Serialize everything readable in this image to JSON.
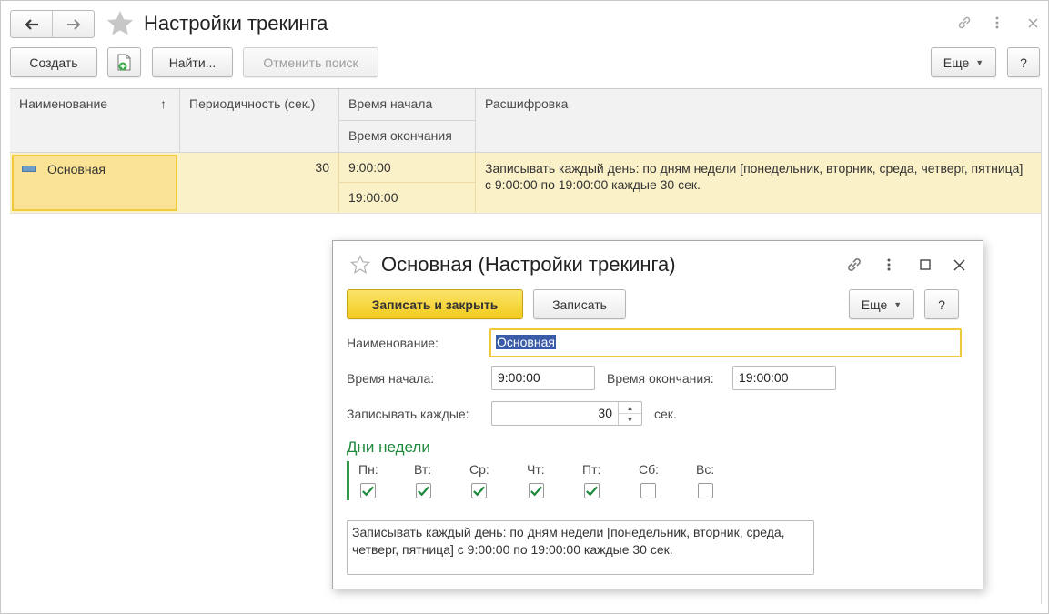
{
  "window": {
    "title": "Настройки трекинга"
  },
  "toolbar": {
    "create_label": "Создать",
    "find_label": "Найти...",
    "cancel_search_label": "Отменить поиск",
    "more_label": "Еще",
    "help_label": "?"
  },
  "table": {
    "columns": {
      "name": "Наименование",
      "sort_indicator": "↑",
      "period": "Периодичность (сек.)",
      "start": "Время начала",
      "end": "Время окончания",
      "decoding": "Расшифровка"
    },
    "rows": [
      {
        "name": "Основная",
        "period": "30",
        "start": "9:00:00",
        "end": "19:00:00",
        "decoding": "Записывать каждый день: по дням недели [понедельник, вторник, среда, четверг, пятница] с 9:00:00 по 19:00:00 каждые 30 сек."
      }
    ]
  },
  "dialog": {
    "title": "Основная (Настройки трекинга)",
    "save_close_label": "Записать и закрыть",
    "save_label": "Записать",
    "more_label": "Еще",
    "help_label": "?",
    "name_label": "Наименование:",
    "name_value": "Основная",
    "start_label": "Время начала:",
    "start_value": "9:00:00",
    "end_label": "Время окончания:",
    "end_value": "19:00:00",
    "every_label": "Записывать каждые:",
    "every_value": "30",
    "every_unit": "сек.",
    "days_header": "Дни недели",
    "days": [
      {
        "label": "Пн:",
        "checked": true
      },
      {
        "label": "Вт:",
        "checked": true
      },
      {
        "label": "Ср:",
        "checked": true
      },
      {
        "label": "Чт:",
        "checked": true
      },
      {
        "label": "Пт:",
        "checked": true
      },
      {
        "label": "Сб:",
        "checked": false
      },
      {
        "label": "Вс:",
        "checked": false
      }
    ],
    "summary": "Записывать каждый день: по дням недели [понедельник, вторник, среда, четверг, пятница] с 9:00:00 по 19:00:00 каждые 30 сек."
  },
  "colors": {
    "accent_green": "#1e8a3c",
    "row_highlight": "#fbf1c9",
    "primary_button": "#f2cb1d",
    "selection": "#3a5ba8"
  }
}
